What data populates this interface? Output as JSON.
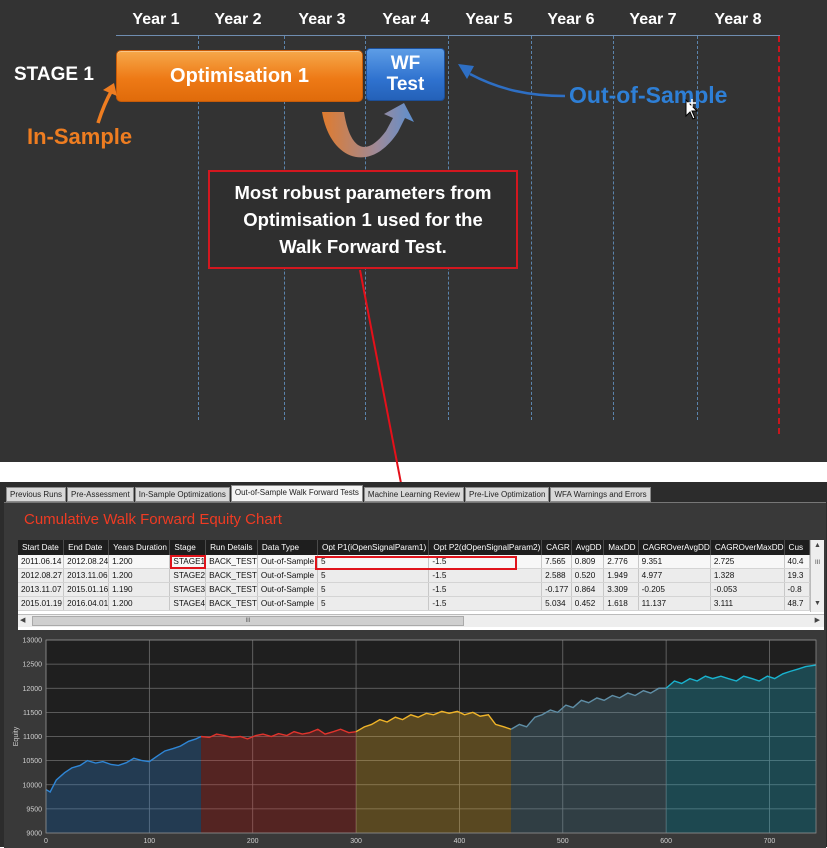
{
  "diagram": {
    "years": [
      "Year 1",
      "Year 2",
      "Year 3",
      "Year 4",
      "Year 5",
      "Year 6",
      "Year 7",
      "Year 8"
    ],
    "stage_label": "STAGE 1",
    "optimisation_label": "Optimisation 1",
    "wf_line1": "WF",
    "wf_line2": "Test",
    "in_sample_label": "In-Sample",
    "out_of_sample_label": "Out-of-Sample",
    "note": "Most robust parameters from Optimisation 1 used for the Walk Forward Test.",
    "colors": {
      "orange": "#ee7a16",
      "blue": "#2f72cf",
      "red": "#d3171f",
      "background": "#333333"
    }
  },
  "app": {
    "tabs": [
      "Previous Runs",
      "Pre-Assessment",
      "In-Sample Optimizations",
      "Out-of-Sample Walk Forward Tests",
      "Machine Learning Review",
      "Pre-Live Optimization",
      "WFA Warnings and Errors"
    ],
    "active_tab": "Out-of-Sample Walk Forward Tests",
    "chart_title": "Cumulative Walk Forward Equity Chart",
    "table": {
      "columns": [
        "Start Date",
        "End Date",
        "Years Duration",
        "Stage",
        "Run Details",
        "Data Type",
        "Opt P1(iOpenSignalParam1)",
        "Opt P2(dOpenSignalParam2)",
        "CAGR",
        "AvgDD",
        "MaxDD",
        "CAGROverAvgDD",
        "CAGROverMaxDD",
        "Cus"
      ],
      "rows": [
        [
          "2011.06.14",
          "2012.08.24",
          "1.200",
          "STAGE1",
          "BACK_TEST",
          "Out-of-Sample",
          "5",
          "-1.5",
          "7.565",
          "0.809",
          "2.776",
          "9.351",
          "2.725",
          "40.4"
        ],
        [
          "2012.08.27",
          "2013.11.06",
          "1.200",
          "STAGE2",
          "BACK_TEST",
          "Out-of-Sample",
          "5",
          "-1.5",
          "2.588",
          "0.520",
          "1.949",
          "4.977",
          "1.328",
          "19.3"
        ],
        [
          "2013.11.07",
          "2015.01.16",
          "1.190",
          "STAGE3",
          "BACK_TEST",
          "Out-of-Sample",
          "5",
          "-1.5",
          "-0.177",
          "0.864",
          "3.309",
          "-0.205",
          "-0.053",
          "-0.8"
        ],
        [
          "2015.01.19",
          "2016.04.01",
          "1.200",
          "STAGE4",
          "BACK_TEST",
          "Out-of-Sample",
          "5",
          "-1.5",
          "5.034",
          "0.452",
          "1.618",
          "11.137",
          "3.111",
          "48.7"
        ]
      ],
      "scroll_glyphs": {
        "up": "▲",
        "down": "▼",
        "left": "◀",
        "right": "▶",
        "grip": "III"
      }
    }
  },
  "chart_data": {
    "type": "area",
    "title": "",
    "xlabel": "",
    "ylabel": "Equity",
    "xlim": [
      0,
      745
    ],
    "ylim": [
      9000,
      13000
    ],
    "x_ticks": [
      0,
      100,
      200,
      300,
      400,
      500,
      600,
      700
    ],
    "y_ticks": [
      9000,
      9500,
      10000,
      10500,
      11000,
      11500,
      12000,
      12500,
      13000
    ],
    "grid": true,
    "series": [
      {
        "color": "#2f86d6",
        "x": [
          0,
          4,
          10,
          18,
          25,
          33,
          40,
          48,
          55,
          63,
          70,
          78,
          85,
          93,
          100,
          108,
          115,
          123,
          130,
          138,
          145,
          150
        ],
        "y": [
          9900,
          9850,
          10100,
          10250,
          10350,
          10400,
          10500,
          10450,
          10480,
          10420,
          10400,
          10460,
          10550,
          10500,
          10480,
          10600,
          10700,
          10750,
          10800,
          10900,
          10950,
          11000
        ]
      },
      {
        "color": "#e0332c",
        "x": [
          150,
          158,
          165,
          173,
          180,
          188,
          195,
          203,
          210,
          218,
          225,
          233,
          240,
          248,
          255,
          263,
          270,
          278,
          285,
          293,
          300
        ],
        "y": [
          11000,
          10980,
          11050,
          11020,
          10980,
          11000,
          10950,
          11020,
          11050,
          11000,
          11060,
          11020,
          11100,
          11050,
          11080,
          11150,
          11050,
          11100,
          11150,
          11080,
          11100
        ]
      },
      {
        "color": "#f0b429",
        "x": [
          300,
          308,
          315,
          323,
          330,
          338,
          345,
          353,
          360,
          368,
          375,
          383,
          390,
          398,
          405,
          413,
          420,
          428,
          435,
          443,
          450
        ],
        "y": [
          11100,
          11200,
          11250,
          11350,
          11300,
          11400,
          11350,
          11450,
          11400,
          11480,
          11450,
          11520,
          11480,
          11520,
          11450,
          11500,
          11420,
          11450,
          11250,
          11200,
          11150
        ]
      },
      {
        "color": "#5f8ea6",
        "x": [
          450,
          458,
          465,
          473,
          480,
          488,
          495,
          503,
          510,
          518,
          525,
          533,
          540,
          548,
          555,
          563,
          570,
          578,
          585,
          593,
          600
        ],
        "y": [
          11150,
          11250,
          11200,
          11400,
          11450,
          11550,
          11500,
          11650,
          11600,
          11750,
          11700,
          11800,
          11750,
          11850,
          11800,
          11900,
          11850,
          11950,
          11900,
          12000,
          12000
        ]
      },
      {
        "color": "#19b3cf",
        "x": [
          600,
          608,
          615,
          623,
          630,
          638,
          645,
          653,
          660,
          668,
          675,
          683,
          690,
          698,
          705,
          713,
          720,
          728,
          735,
          745
        ],
        "y": [
          12000,
          12150,
          12100,
          12200,
          12150,
          12250,
          12200,
          12250,
          12200,
          12150,
          12250,
          12200,
          12150,
          12250,
          12200,
          12300,
          12350,
          12400,
          12450,
          12480
        ]
      }
    ]
  }
}
